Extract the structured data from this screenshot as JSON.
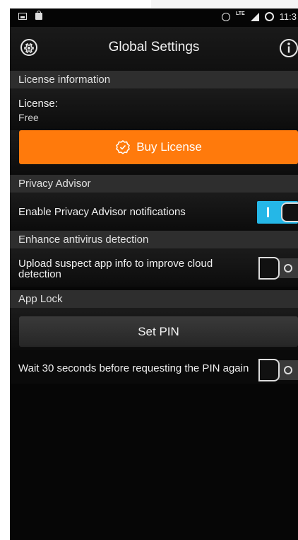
{
  "status_bar": {
    "time": "11:3",
    "network": "LTE"
  },
  "app_bar": {
    "title": "Global Settings",
    "left_icon": "gear-icon",
    "right_icon": "info-icon"
  },
  "license_section": {
    "header": "License information",
    "license_label": "License:",
    "license_value": "Free",
    "buy_button_label": "Buy License",
    "buy_button_icon": "badge-check-icon",
    "accent_color": "#ff7a0c"
  },
  "privacy_section": {
    "header": "Privacy Advisor",
    "row_label": "Enable Privacy Advisor notifications",
    "toggle_on": true,
    "toggle_color": "#25b7e7"
  },
  "antivirus_section": {
    "header": "Enhance antivirus detection",
    "row_label_line1": "Upload suspect app info to improve cloud",
    "row_label_line2": "detection",
    "toggle_on": false
  },
  "app_lock_section": {
    "header": "App Lock",
    "set_pin_label": "Set PIN",
    "wait_label": "Wait 30 seconds before requesting the PIN again",
    "toggle_on": false
  }
}
